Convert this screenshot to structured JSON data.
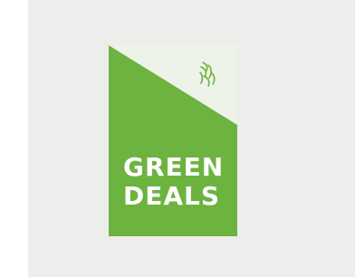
{
  "logo": {
    "line1": "GREEN",
    "line2": "DEALS",
    "emblem_icon": "flemish-lion-icon",
    "colors": {
      "green": "#6cb33f",
      "light": "#eef3ea",
      "background": "#ededeb",
      "text": "#ffffff"
    }
  }
}
